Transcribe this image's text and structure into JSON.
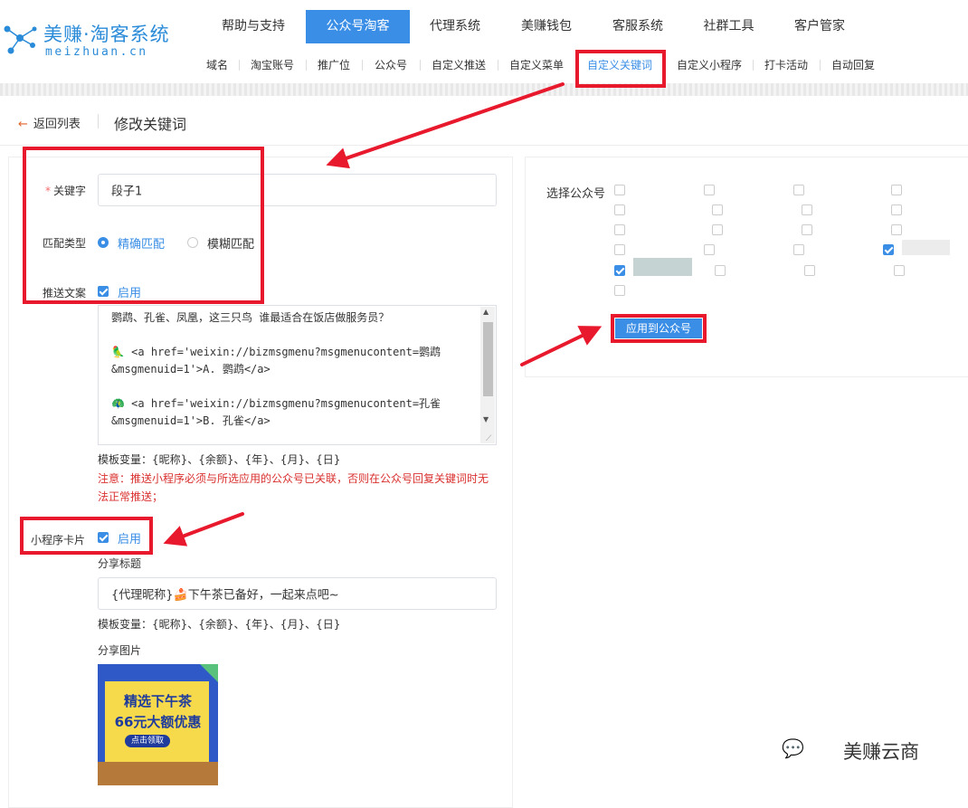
{
  "logo": {
    "title": "美赚·淘客系统",
    "subtitle": "meizhuan.cn"
  },
  "top_nav": [
    "帮助与支持",
    "公众号淘客",
    "代理系统",
    "美赚钱包",
    "客服系统",
    "社群工具",
    "客户管家"
  ],
  "sub_nav": [
    "域名",
    "淘宝账号",
    "推广位",
    "公众号",
    "自定义推送",
    "自定义菜单",
    "自定义关键词",
    "自定义小程序",
    "打卡活动",
    "自动回复"
  ],
  "breadcrumb": {
    "back": "返回列表",
    "title": "修改关键词"
  },
  "form": {
    "keyword_label": "关键字",
    "keyword_value": "段子1",
    "match_label": "匹配类型",
    "match_exact": "精确匹配",
    "match_fuzzy": "模糊匹配",
    "push_label": "推送文案",
    "push_enable": "启用",
    "push_text": "鹦鹉、孔雀、凤凰，这三只鸟 谁最适合在饭店做服务员？\n\n🦜 <a href='weixin://bizmsgmenu?msgmenucontent=鹦鹉\n&msgmenuid=1'>A. 鹦鹉</a>\n\n🦚 <a href='weixin://bizmsgmenu?msgmenucontent=孔雀\n&msgmenuid=1'>B. 孔雀</a>",
    "template_vars": "模板变量：{昵称}、{余额}、{年}、{月}、{日}",
    "warning": "注意：推送小程序必须与所选应用的公众号已关联，否则在公众号回复关键词时无法正常推送；",
    "miniapp_label": "小程序卡片",
    "miniapp_enable": "启用",
    "share_title_label": "分享标题",
    "share_title_value": "{代理昵称}🍰下午茶已备好，一起来点吧~",
    "template_vars2": "模板变量：{昵称}、{余额}、{年}、{月}、{日}",
    "share_image_label": "分享图片",
    "share_image": {
      "line1": "精选下午茶",
      "line2": "66元大额优惠",
      "button": "点击领取"
    }
  },
  "right": {
    "select_label": "选择公众号",
    "apply_button": "应用到公众号"
  },
  "watermark": "美赚云商",
  "colors": {
    "accent": "#3a8ee6",
    "annotation": "#e8192c"
  }
}
